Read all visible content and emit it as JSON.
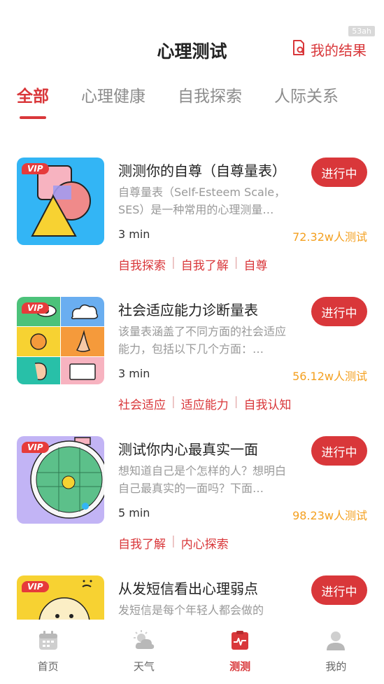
{
  "status_bar": {
    "battery_badge": "53ah"
  },
  "header": {
    "title": "心理测试",
    "results_label": "我的结果"
  },
  "tabs": [
    {
      "label": "全部"
    },
    {
      "label": "心理健康"
    },
    {
      "label": "自我探索"
    },
    {
      "label": "人际关系"
    }
  ],
  "cards": [
    {
      "vip": "VIP",
      "title": "测测你的自尊（自尊量表）",
      "desc": "自尊量表（Self-Esteem Scale，SES）是一种常用的心理测量…",
      "duration": "3 min",
      "count": "72.32w人测试",
      "tags": [
        "自我探索",
        "自我了解",
        "自尊"
      ],
      "status": "进行中"
    },
    {
      "vip": "VIP",
      "title": "社会适应能力诊断量表",
      "desc": "该量表涵盖了不同方面的社会适应能力，包括以下几个方面：…",
      "duration": "3 min",
      "count": "56.12w人测试",
      "tags": [
        "社会适应",
        "适应能力",
        "自我认知"
      ],
      "status": "进行中"
    },
    {
      "vip": "VIP",
      "title": "测试你内心最真实一面",
      "desc": "想知道自己是个怎样的人？想明白自己最真实的一面吗？下面…",
      "duration": "5 min",
      "count": "98.23w人测试",
      "tags": [
        "自我了解",
        "内心探索"
      ],
      "status": "进行中"
    },
    {
      "vip": "VIP",
      "title": "从发短信看出心理弱点",
      "desc": "发短信是每个年轻人都会做的",
      "status": "进行中"
    }
  ],
  "bottom_nav": [
    {
      "label": "首页",
      "icon": "calendar-icon"
    },
    {
      "label": "天气",
      "icon": "weather-icon"
    },
    {
      "label": "测测",
      "icon": "pulse-clipboard-icon"
    },
    {
      "label": "我的",
      "icon": "person-icon"
    }
  ],
  "colors": {
    "accent": "#d9373a",
    "count": "#f4a020",
    "muted": "#999999"
  }
}
